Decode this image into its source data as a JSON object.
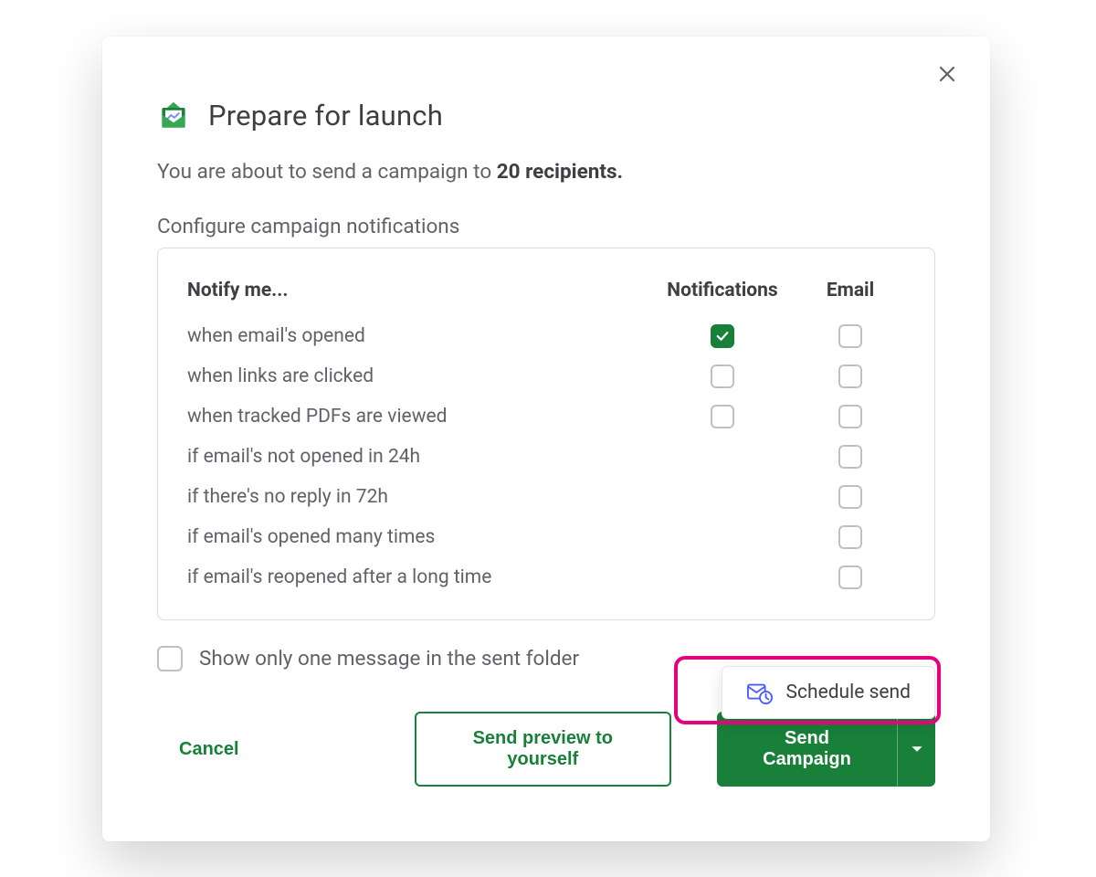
{
  "dialog": {
    "title": "Prepare for launch",
    "subtitle_prefix": "You are about to send a campaign to ",
    "subtitle_strong": "20 recipients.",
    "configure_label": "Configure campaign notifications",
    "columns": {
      "notify_me": "Notify me...",
      "notifications": "Notifications",
      "email": "Email"
    },
    "rows": [
      {
        "label": "when email's opened",
        "notifications": true,
        "email": false
      },
      {
        "label": "when links are clicked",
        "notifications": false,
        "email": false
      },
      {
        "label": "when tracked PDFs are viewed",
        "notifications": false,
        "email": false
      },
      {
        "label": "if email's not opened in 24h",
        "notifications": null,
        "email": false
      },
      {
        "label": "if there's no reply in 72h",
        "notifications": null,
        "email": false
      },
      {
        "label": "if email's opened many times",
        "notifications": null,
        "email": false
      },
      {
        "label": "if email's reopened after a long time",
        "notifications": null,
        "email": false
      }
    ],
    "sent_folder_label": "Show only one message in the sent folder",
    "sent_folder_checked": false,
    "buttons": {
      "cancel": "Cancel",
      "preview": "Send preview to yourself",
      "send": "Send Campaign",
      "schedule": "Schedule send"
    }
  }
}
